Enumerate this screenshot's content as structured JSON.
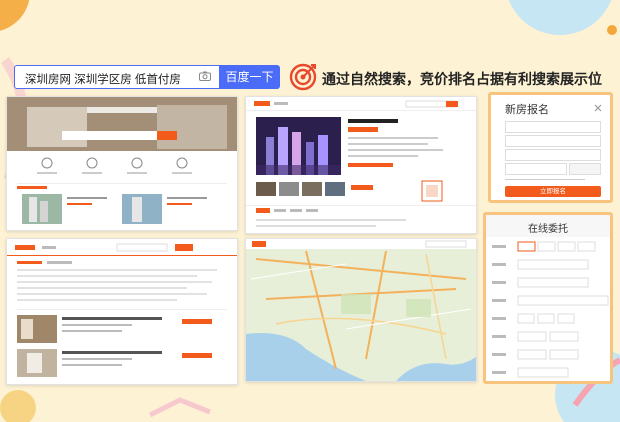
{
  "search": {
    "query": "深圳房网  深圳学区房  低首付房",
    "button_label": "百度一下"
  },
  "headline": {
    "text": "通过自然搜索，竞价排名占据有利搜索展示位"
  },
  "signup_panel": {
    "title": "新房报名",
    "submit_label": "立即报名"
  },
  "commission_panel": {
    "title": "在线委托"
  },
  "colors": {
    "accent_blue": "#4a6cf7",
    "brand_orange": "#f35b1c",
    "panel_border": "#f8c47d",
    "background": "#fdf2d4"
  },
  "icons": [
    "camera-icon",
    "target-icon",
    "close-icon",
    "map-pin-icon"
  ]
}
